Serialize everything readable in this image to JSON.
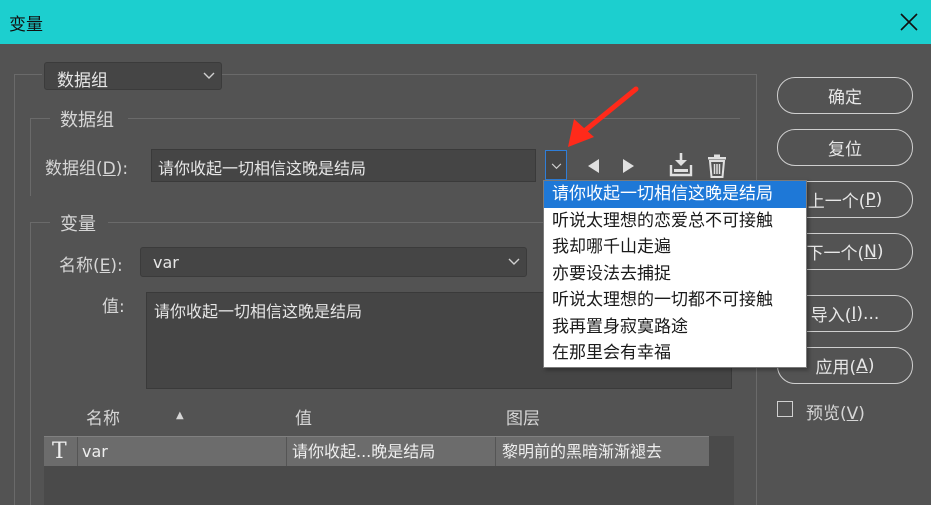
{
  "window": {
    "title": "变量"
  },
  "top_select": {
    "value": "数据组"
  },
  "dataset_group": {
    "title": "数据组",
    "label": "数据组(",
    "mnemonic": "D",
    "label_end": "):",
    "value": "请你收起一切相信这晚是结局"
  },
  "dropdown": {
    "options": [
      "请你收起一切相信这晚是结局",
      "听说太理想的恋爱总不可接触",
      "我却哪千山走遍",
      "亦要设法去捕捉",
      "听说太理想的一切都不可接触",
      "我再置身寂寞路途",
      "在那里会有幸福"
    ],
    "selected_index": 0
  },
  "variable_group": {
    "title": "变量",
    "name_label": "名称(",
    "name_mnemonic": "E",
    "name_label_end": "):",
    "name_value": "var",
    "value_label": "值:",
    "value_text": "请你收起一切相信这晚是结局"
  },
  "table": {
    "headers": {
      "name": "名称",
      "sort_glyph": "▲",
      "value": "值",
      "layer": "图层"
    },
    "rows": [
      {
        "type_glyph": "T",
        "name": "var",
        "value": "请你收起...晚是结局",
        "layer": "黎明前的黑暗渐渐褪去"
      }
    ]
  },
  "buttons": {
    "ok": "确定",
    "reset": "复位",
    "prev": {
      "pre": "上一个(",
      "key": "P",
      "post": ")"
    },
    "next": {
      "pre": "下一个(",
      "key": "N",
      "post": ")"
    },
    "import": {
      "pre": "导入(",
      "key": "I",
      "post": ")..."
    },
    "apply": {
      "pre": "应用(",
      "key": "A",
      "post": ")"
    }
  },
  "preview": {
    "pre": "预览(",
    "key": "V",
    "post": ")",
    "checked": false
  },
  "colors": {
    "titlebar": "#1ccfcf",
    "background": "#535353",
    "selection": "#1e78d7",
    "annotation_arrow": "#ff2a1a"
  }
}
